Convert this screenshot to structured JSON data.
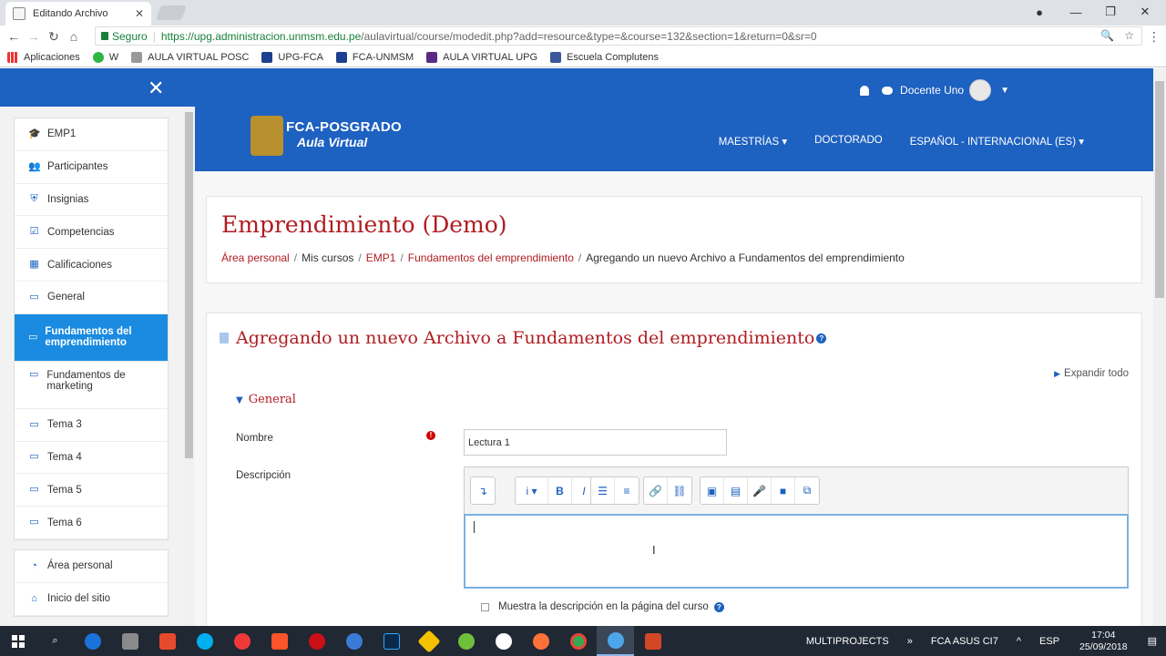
{
  "browser": {
    "tab_title": "Editando Archivo",
    "secure_label": "Seguro",
    "url_host": "https://upg.administracion.unmsm.edu.pe",
    "url_path": "/aulavirtual/course/modedit.php?add=resource&type=&course=132&section=1&return=0&sr=0",
    "bookmarks": [
      "Aplicaciones",
      "W",
      "AULA VIRTUAL POSC",
      "UPG-FCA",
      "FCA-UNMSM",
      "AULA VIRTUAL UPG",
      "Escuela Complutens"
    ]
  },
  "topnav": {
    "user_name": "Docente Uno"
  },
  "banner": {
    "logo_line1": "FCA-POSGRADO",
    "logo_line2": "Aula Virtual",
    "menu": [
      "MAESTRÍAS ▾",
      "DOCTORADO",
      "ESPAÑOL - INTERNACIONAL (ES) ▾"
    ]
  },
  "sidebar": {
    "course_items": [
      {
        "label": "EMP1",
        "icon": "graduation-cap-icon",
        "glyph": "🎓"
      },
      {
        "label": "Participantes",
        "icon": "users-icon",
        "glyph": "👥"
      },
      {
        "label": "Insignias",
        "icon": "shield-icon",
        "glyph": "⛨"
      },
      {
        "label": "Competencias",
        "icon": "check-square-icon",
        "glyph": "☑"
      },
      {
        "label": "Calificaciones",
        "icon": "table-icon",
        "glyph": "▦"
      },
      {
        "label": "General",
        "icon": "folder-icon",
        "glyph": "▭"
      },
      {
        "label": "Fundamentos del emprendimiento",
        "icon": "folder-icon",
        "glyph": "▭"
      },
      {
        "label": "Fundamentos de marketing",
        "icon": "folder-icon",
        "glyph": "▭"
      },
      {
        "label": "Tema 3",
        "icon": "folder-icon",
        "glyph": "▭"
      },
      {
        "label": "Tema 4",
        "icon": "folder-icon",
        "glyph": "▭"
      },
      {
        "label": "Tema 5",
        "icon": "folder-icon",
        "glyph": "▭"
      },
      {
        "label": "Tema 6",
        "icon": "folder-icon",
        "glyph": "▭"
      }
    ],
    "site_items": [
      {
        "label": "Área personal",
        "icon": "dashboard-icon",
        "glyph": "◔"
      },
      {
        "label": "Inicio del sitio",
        "icon": "home-icon",
        "glyph": "⌂"
      }
    ]
  },
  "course": {
    "title": "Emprendimiento (Demo)",
    "breadcrumb": [
      {
        "label": "Área personal",
        "link": true
      },
      {
        "label": "Mis cursos",
        "link": false
      },
      {
        "label": "EMP1",
        "link": true
      },
      {
        "label": "Fundamentos del emprendimiento",
        "link": true
      },
      {
        "label": "Agregando un nuevo Archivo a Fundamentos del emprendimiento",
        "link": false
      }
    ]
  },
  "form": {
    "title": "Agregando un nuevo Archivo a Fundamentos del emprendimiento",
    "help_glyph": "?",
    "expand_all": "Expandir todo",
    "section_general": "General",
    "name_label": "Nombre",
    "name_value": "Lectura 1",
    "required_glyph": "!",
    "description_label": "Descripción",
    "show_description_label": "Muestra la descripción en la página del curso"
  },
  "toolbar_groups": [
    [
      "↴"
    ],
    [
      "i ▾",
      "B",
      "I"
    ],
    [
      "☰",
      "≡"
    ],
    [
      "🔗",
      "⛓"
    ],
    [
      "▣",
      "▤",
      "🎤",
      "■",
      "⧉"
    ]
  ],
  "taskbar": {
    "tray_items": [
      "MULTIPROJECTS",
      "FCA ASUS CI7",
      "ESP"
    ],
    "time": "17:04",
    "date": "25/09/2018"
  },
  "colors": {
    "moodle_blue": "#1d61c1",
    "title_red": "#b01c22",
    "active_item": "#1a8be0"
  }
}
